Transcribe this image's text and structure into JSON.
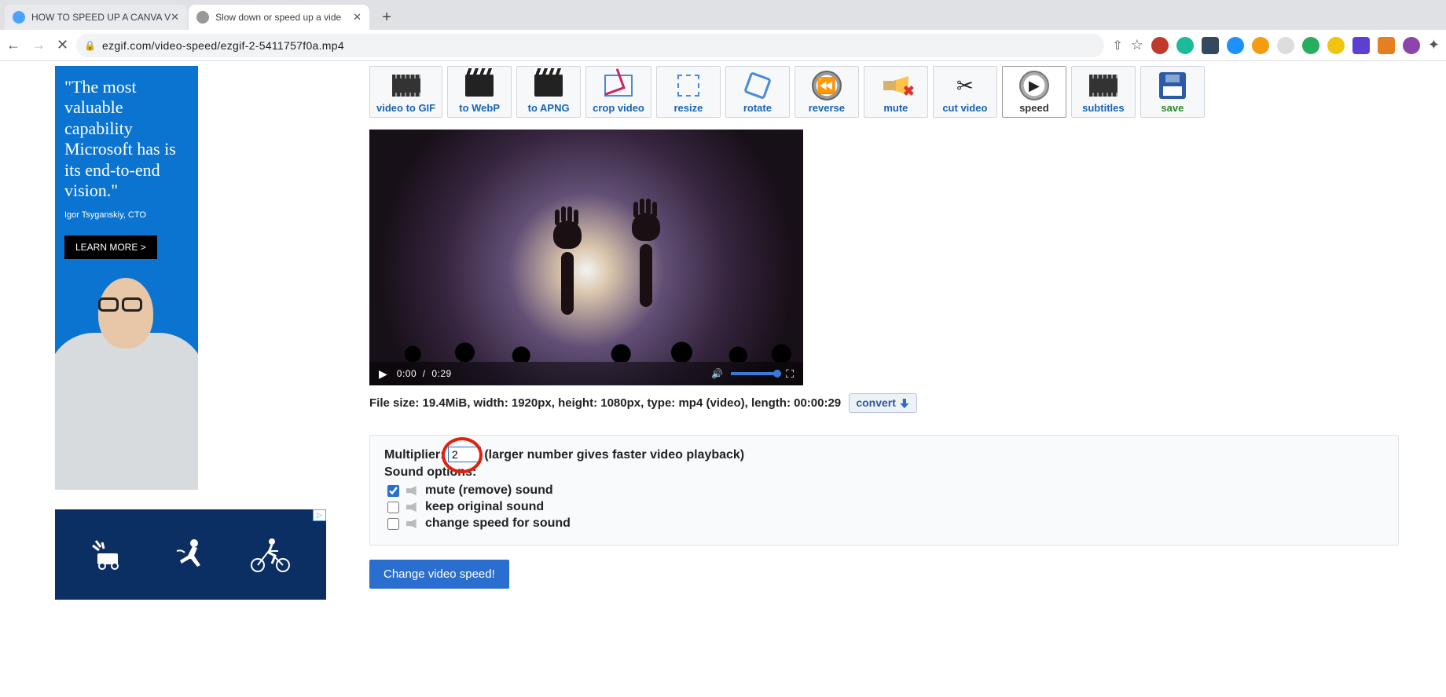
{
  "browser": {
    "tabs": [
      {
        "title": "HOW TO SPEED UP A CANVA V",
        "active": false
      },
      {
        "title": "Slow down or speed up a vide",
        "active": true
      }
    ],
    "url": "ezgif.com/video-speed/ezgif-2-5411757f0a.mp4"
  },
  "ads": {
    "quote": "\"The most valuable capability Microsoft has is its end-to-end vision.\"",
    "attrib": "Igor Tsyganskiy, CTO",
    "cta": "LEARN MORE >"
  },
  "tools": [
    {
      "id": "video-to-gif",
      "label": "video to GIF"
    },
    {
      "id": "to-webp",
      "label": "to WebP"
    },
    {
      "id": "to-apng",
      "label": "to APNG"
    },
    {
      "id": "crop",
      "label": "crop video"
    },
    {
      "id": "resize",
      "label": "resize"
    },
    {
      "id": "rotate",
      "label": "rotate"
    },
    {
      "id": "reverse",
      "label": "reverse"
    },
    {
      "id": "mute",
      "label": "mute"
    },
    {
      "id": "cut",
      "label": "cut video"
    },
    {
      "id": "speed",
      "label": "speed",
      "active": true
    },
    {
      "id": "subtitles",
      "label": "subtitles"
    },
    {
      "id": "save",
      "label": "save"
    }
  ],
  "video": {
    "current": "0:00",
    "duration": "0:29"
  },
  "meta": {
    "text": "File size: 19.4MiB, width: 1920px, height: 1080px, type: mp4 (video), length: 00:00:29",
    "convert": "convert"
  },
  "form": {
    "multiplier_label": "Multiplier:",
    "multiplier_value": "2",
    "multiplier_hint": "(larger number gives faster video playback)",
    "sound_heading": "Sound options:",
    "opt_mute": "mute (remove) sound",
    "opt_keep": "keep original sound",
    "opt_change": "change speed for sound",
    "submit": "Change video speed!"
  }
}
